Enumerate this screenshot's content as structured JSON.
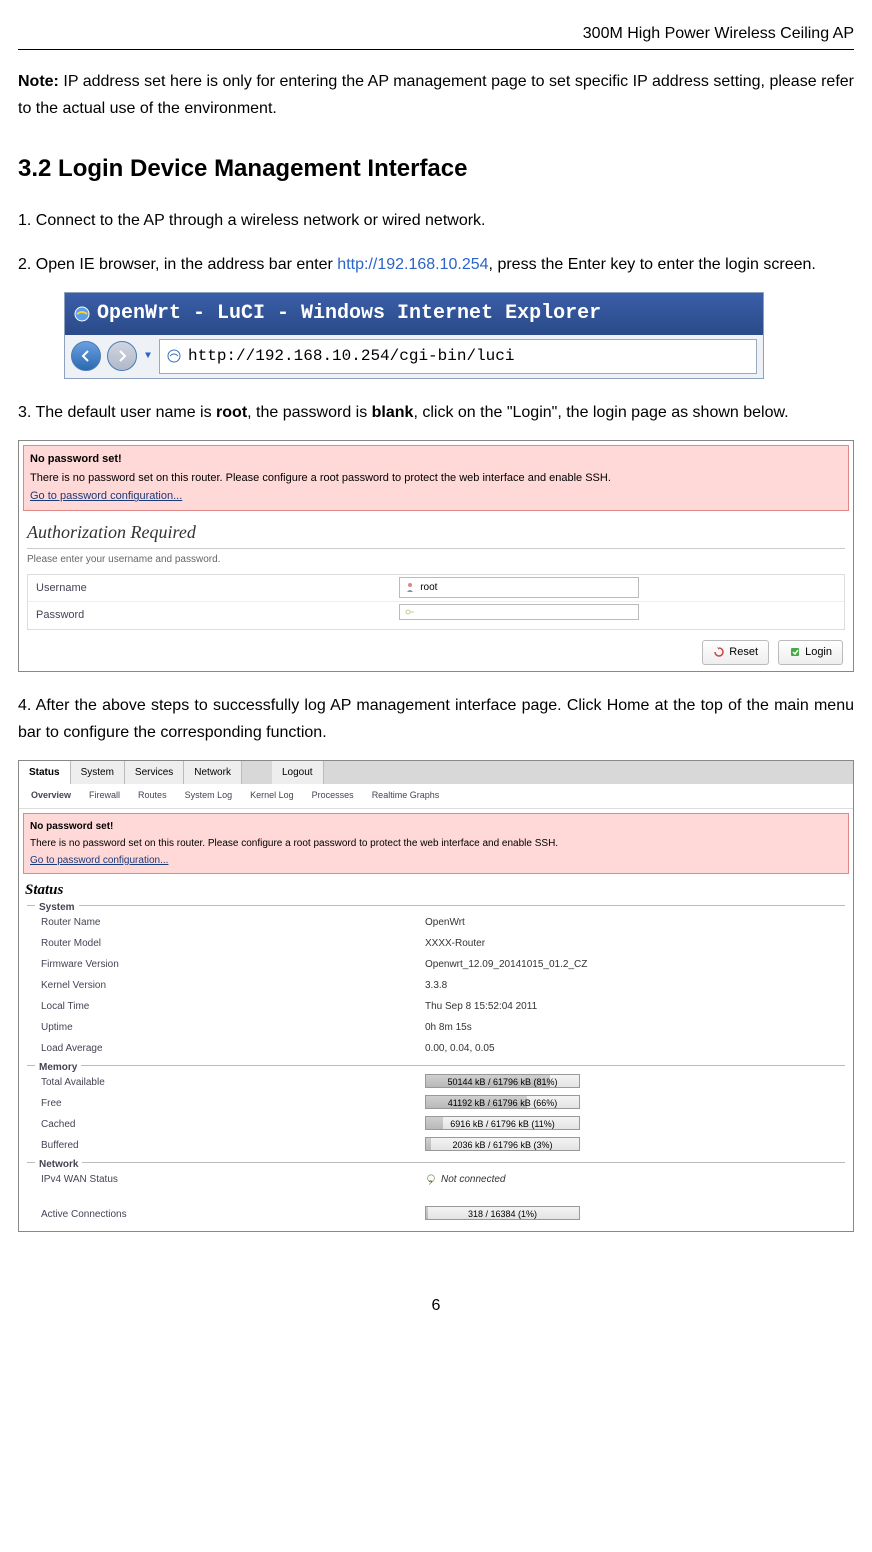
{
  "header": {
    "doc_title": "300M High Power Wireless Ceiling AP"
  },
  "note": {
    "label": "Note:",
    "text": " IP address set here is only for entering the AP management page to set specific IP address setting, please refer to the actual use of the environment."
  },
  "section_heading": "3.2 Login Device Management Interface",
  "step1": "1. Connect to the AP through a wireless network or wired network.",
  "step2": {
    "pre": "2. Open IE browser, in the address bar enter ",
    "url": "http://192.168.10.254",
    "post": ", press the Enter key to enter the login screen."
  },
  "ie": {
    "title": "OpenWrt - LuCI - Windows Internet Explorer",
    "address": "http://192.168.10.254/cgi-bin/luci"
  },
  "step3": {
    "pre": "3. The default user name is ",
    "u": "root",
    "mid": ", the password is ",
    "p": "blank",
    "post": ", click on the \"Login\", the login page as shown below."
  },
  "login": {
    "warn_title": "No password set!",
    "warn_text": "There is no password set on this router. Please configure a root password to protect the web interface and enable SSH.",
    "warn_link": "Go to password configuration...",
    "auth_title": "Authorization Required",
    "auth_sub": "Please enter your username and password.",
    "username_label": "Username",
    "username_value": "root",
    "password_label": "Password",
    "password_value": "",
    "reset": "Reset",
    "login_btn": "Login"
  },
  "step4": "4. After the above steps to successfully log AP management interface page. Click Home at the top of the main menu bar to configure the corresponding function.",
  "status": {
    "main_tabs": [
      "Status",
      "System",
      "Services",
      "Network",
      "Logout"
    ],
    "sub_tabs": [
      "Overview",
      "Firewall",
      "Routes",
      "System Log",
      "Kernel Log",
      "Processes",
      "Realtime Graphs"
    ],
    "warn_title": "No password set!",
    "warn_text": "There is no password set on this router. Please configure a root password to protect the web interface and enable SSH.",
    "warn_link": "Go to password configuration...",
    "title": "Status",
    "system_legend": "System",
    "system": [
      {
        "label": "Router Name",
        "value": "OpenWrt"
      },
      {
        "label": "Router Model",
        "value": "XXXX-Router"
      },
      {
        "label": "Firmware Version",
        "value": "Openwrt_12.09_20141015_01.2_CZ"
      },
      {
        "label": "Kernel Version",
        "value": "3.3.8"
      },
      {
        "label": "Local Time",
        "value": "Thu Sep 8 15:52:04 2011"
      },
      {
        "label": "Uptime",
        "value": "0h 8m 15s"
      },
      {
        "label": "Load Average",
        "value": "0.00, 0.04, 0.05"
      }
    ],
    "memory_legend": "Memory",
    "memory": [
      {
        "label": "Total Available",
        "text": "50144 kB / 61796 kB (81%)",
        "pct": 81
      },
      {
        "label": "Free",
        "text": "41192 kB / 61796 kB (66%)",
        "pct": 66
      },
      {
        "label": "Cached",
        "text": "6916 kB / 61796 kB (11%)",
        "pct": 11
      },
      {
        "label": "Buffered",
        "text": "2036 kB / 61796 kB (3%)",
        "pct": 3
      }
    ],
    "network_legend": "Network",
    "wan_label": "IPv4 WAN Status",
    "wan_value": "Not connected",
    "conn_label": "Active Connections",
    "conn_text": "318 / 16384 (1%)",
    "conn_pct": 1
  },
  "page_number": "6"
}
